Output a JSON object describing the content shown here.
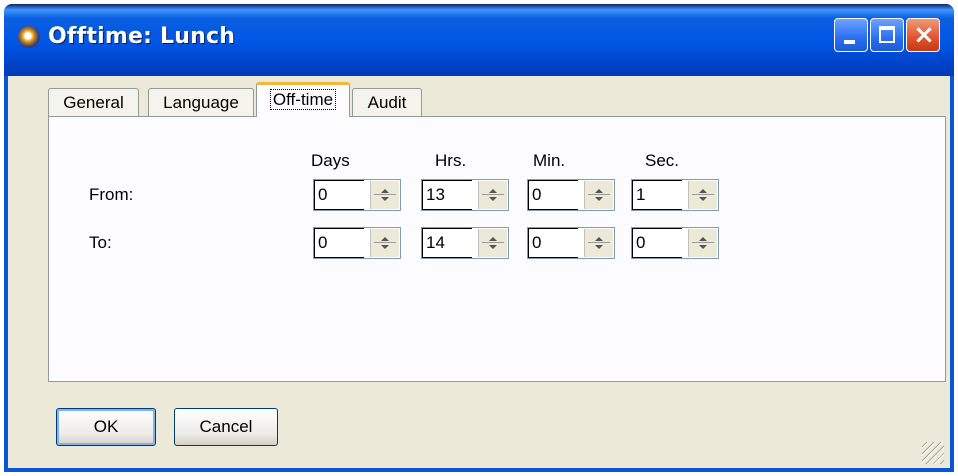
{
  "window": {
    "title": "Offtime: Lunch"
  },
  "tabs": [
    {
      "label": "General",
      "selected": false
    },
    {
      "label": "Language",
      "selected": false
    },
    {
      "label": "Off-time",
      "selected": true
    },
    {
      "label": "Audit",
      "selected": false
    }
  ],
  "columns": {
    "days": "Days",
    "hrs": "Hrs.",
    "min": "Min.",
    "sec": "Sec."
  },
  "rows": {
    "from": {
      "label": "From:",
      "days": "0",
      "hrs": "13",
      "min": "0",
      "sec": "1"
    },
    "to": {
      "label": "To:",
      "days": "0",
      "hrs": "14",
      "min": "0",
      "sec": "0"
    }
  },
  "buttons": {
    "ok": "OK",
    "cancel": "Cancel"
  },
  "icons": {
    "app": "app-globe-icon",
    "minimize": "minimize-icon",
    "maximize": "maximize-icon",
    "close": "close-icon",
    "resize": "resize-grip-icon"
  },
  "colors": {
    "titlebar": "#0055e5",
    "window_bg": "#ece9d8",
    "close_button": "#e0522b",
    "selected_tab_accent": "#f3b63c"
  }
}
